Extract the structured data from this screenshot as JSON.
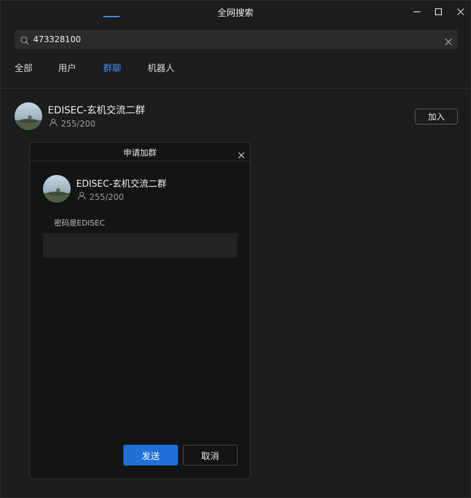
{
  "window": {
    "title": "全网搜索",
    "icons": [
      "minimize-icon",
      "maximize-icon",
      "close-icon"
    ]
  },
  "search": {
    "value": "473328100",
    "placeholder": "",
    "icon": "search-icon",
    "clear_icon": "clear-icon"
  },
  "tabs": [
    {
      "label": "全部",
      "active": false
    },
    {
      "label": "用户",
      "active": false
    },
    {
      "label": "群聊",
      "active": true
    },
    {
      "label": "机器人",
      "active": false
    }
  ],
  "result": {
    "name": "EDISEC-玄机交流二群",
    "member_count": "255/200",
    "join_label": "加入"
  },
  "dialog": {
    "title": "申请加群",
    "group_name": "EDISEC-玄机交流二群",
    "member_count": "255/200",
    "message": "密码是EDISEC",
    "input_value": "",
    "send_label": "发送",
    "cancel_label": "取消"
  },
  "colors": {
    "accent": "#3d8ef2",
    "primary_button": "#1f6fd6",
    "background": "#1c1c1c",
    "dialog_background": "#141414"
  }
}
